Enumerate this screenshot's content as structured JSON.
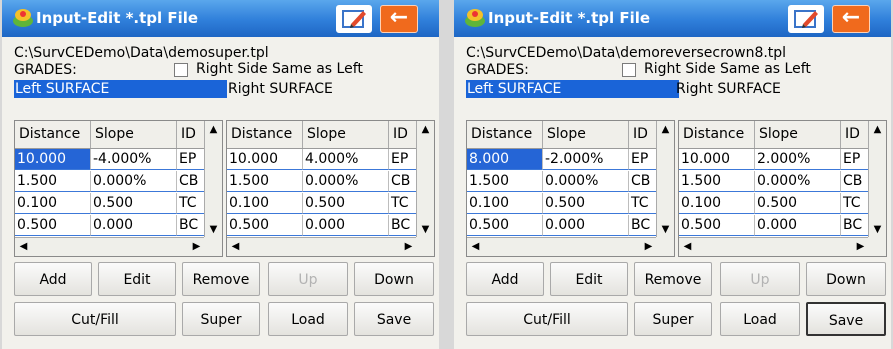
{
  "panels": [
    {
      "title": "Input-Edit *.tpl File",
      "back_icon": "←",
      "path": "C:\\SurvCEDemo\\Data\\demosuper.tpl",
      "grades_label": "GRADES:",
      "right_same_label": "Right Side Same as Left",
      "left_surface_label": "Left SURFACE",
      "right_surface_label": "Right SURFACE",
      "left_table": {
        "headers": [
          "Distance",
          "Slope",
          "ID"
        ],
        "rows": [
          [
            "10.000",
            "-4.000%",
            "EP"
          ],
          [
            "1.500",
            "0.000%",
            "CB"
          ],
          [
            "0.100",
            "0.500",
            "TC"
          ],
          [
            "0.500",
            "0.000",
            "BC"
          ]
        ]
      },
      "right_table": {
        "headers": [
          "Distance",
          "Slope",
          "ID"
        ],
        "rows": [
          [
            "10.000",
            "4.000%",
            "EP"
          ],
          [
            "1.500",
            "0.000%",
            "CB"
          ],
          [
            "0.100",
            "0.500",
            "TC"
          ],
          [
            "0.500",
            "0.000",
            "BC"
          ]
        ]
      },
      "buttons": {
        "add": "Add",
        "edit": "Edit",
        "remove": "Remove",
        "up": "Up",
        "down": "Down",
        "cutfill": "Cut/Fill",
        "super": "Super",
        "load": "Load",
        "save": "Save"
      }
    },
    {
      "title": "Input-Edit *.tpl File",
      "back_icon": "←",
      "path": "C:\\SurvCEDemo\\Data\\demoreversecrown8.tpl",
      "grades_label": "GRADES:",
      "right_same_label": "Right Side Same as Left",
      "left_surface_label": "Left SURFACE",
      "right_surface_label": "Right SURFACE",
      "left_table": {
        "headers": [
          "Distance",
          "Slope",
          "ID"
        ],
        "rows": [
          [
            "8.000",
            "-2.000%",
            "EP"
          ],
          [
            "1.500",
            "0.000%",
            "CB"
          ],
          [
            "0.100",
            "0.500",
            "TC"
          ],
          [
            "0.500",
            "0.000",
            "BC"
          ]
        ]
      },
      "right_table": {
        "headers": [
          "Distance",
          "Slope",
          "ID"
        ],
        "rows": [
          [
            "10.000",
            "2.000%",
            "EP"
          ],
          [
            "1.500",
            "0.000%",
            "CB"
          ],
          [
            "0.100",
            "0.500",
            "TC"
          ],
          [
            "0.500",
            "0.000",
            "BC"
          ]
        ]
      },
      "buttons": {
        "add": "Add",
        "edit": "Edit",
        "remove": "Remove",
        "up": "Up",
        "down": "Down",
        "cutfill": "Cut/Fill",
        "super": "Super",
        "load": "Load",
        "save": "Save"
      }
    }
  ],
  "colors": {
    "title_bar": "#2f7fda",
    "selection": "#1a64d8",
    "back_button": "#f06a1d"
  },
  "icons": {
    "app": "surveyor-logo-icon",
    "edit": "edit-pen-icon",
    "back": "back-arrow-icon",
    "scroll_up": "scroll-up-icon",
    "scroll_down": "scroll-down-icon",
    "scroll_left": "scroll-left-icon",
    "scroll_right": "scroll-right-icon"
  }
}
